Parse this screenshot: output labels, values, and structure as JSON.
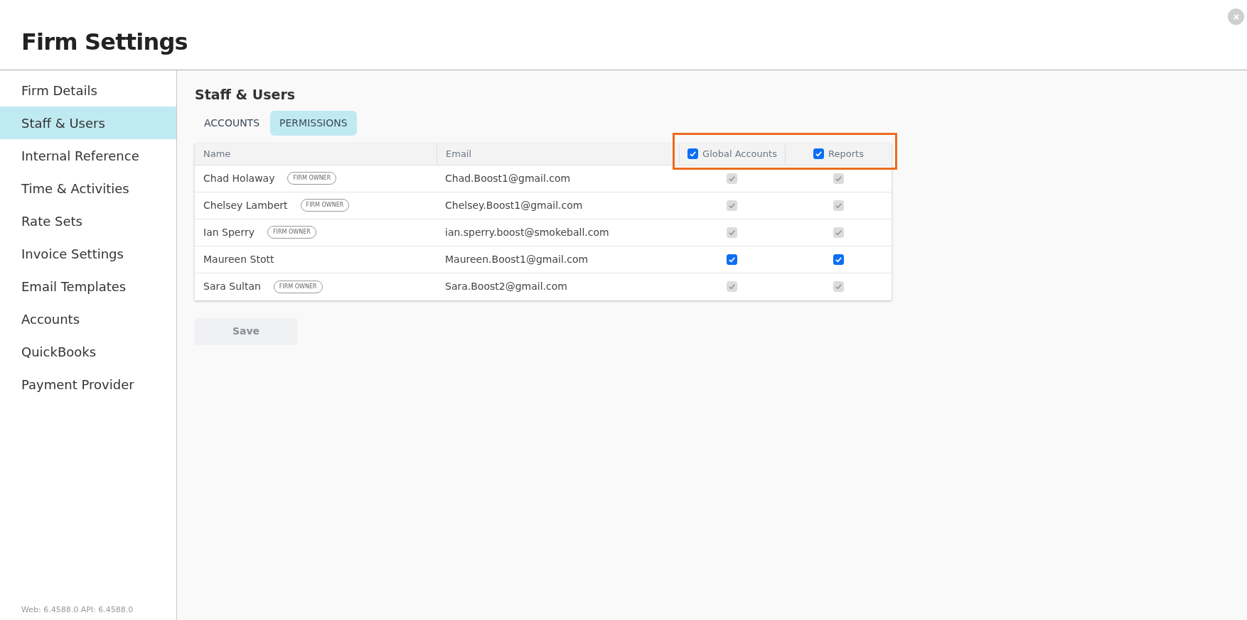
{
  "window": {
    "title": "Firm Settings"
  },
  "sidebar": {
    "items": [
      {
        "label": "Firm Details",
        "selected": false
      },
      {
        "label": "Staff & Users",
        "selected": true
      },
      {
        "label": "Internal Reference",
        "selected": false
      },
      {
        "label": "Time & Activities",
        "selected": false
      },
      {
        "label": "Rate Sets",
        "selected": false
      },
      {
        "label": "Invoice Settings",
        "selected": false
      },
      {
        "label": "Email Templates",
        "selected": false
      },
      {
        "label": "Accounts",
        "selected": false
      },
      {
        "label": "QuickBooks",
        "selected": false
      },
      {
        "label": "Payment Provider",
        "selected": false
      }
    ],
    "version": "Web: 6.4588.0 API: 6.4588.0"
  },
  "section": {
    "title": "Staff & Users"
  },
  "tabs": [
    {
      "label": "ACCOUNTS",
      "selected": false
    },
    {
      "label": "PERMISSIONS",
      "selected": true
    }
  ],
  "table": {
    "columns": [
      {
        "label": "Name",
        "kind": "text"
      },
      {
        "label": "Email",
        "kind": "text"
      },
      {
        "label": "Global Accounts",
        "kind": "checkbox",
        "checked": true
      },
      {
        "label": "Reports",
        "kind": "checkbox",
        "checked": true
      }
    ],
    "rows": [
      {
        "name": "Chad Holaway",
        "badge": "FIRM OWNER",
        "email": "Chad.Boost1@gmail.com",
        "permissions": [
          {
            "checked": true,
            "disabled": true
          },
          {
            "checked": true,
            "disabled": true
          }
        ]
      },
      {
        "name": "Chelsey Lambert",
        "badge": "FIRM OWNER",
        "email": "Chelsey.Boost1@gmail.com",
        "permissions": [
          {
            "checked": true,
            "disabled": true
          },
          {
            "checked": true,
            "disabled": true
          }
        ]
      },
      {
        "name": "Ian Sperry",
        "badge": "FIRM OWNER",
        "email": "ian.sperry.boost@smokeball.com",
        "permissions": [
          {
            "checked": true,
            "disabled": true
          },
          {
            "checked": true,
            "disabled": true
          }
        ]
      },
      {
        "name": "Maureen Stott",
        "email": "Maureen.Boost1@gmail.com",
        "permissions": [
          {
            "checked": true,
            "disabled": false
          },
          {
            "checked": true,
            "disabled": false
          }
        ]
      },
      {
        "name": "Sara Sultan",
        "badge": "FIRM OWNER",
        "email": "Sara.Boost2@gmail.com",
        "permissions": [
          {
            "checked": true,
            "disabled": true
          },
          {
            "checked": true,
            "disabled": true
          }
        ]
      }
    ]
  },
  "buttons": [
    {
      "label": "Save",
      "disabled": true
    }
  ]
}
